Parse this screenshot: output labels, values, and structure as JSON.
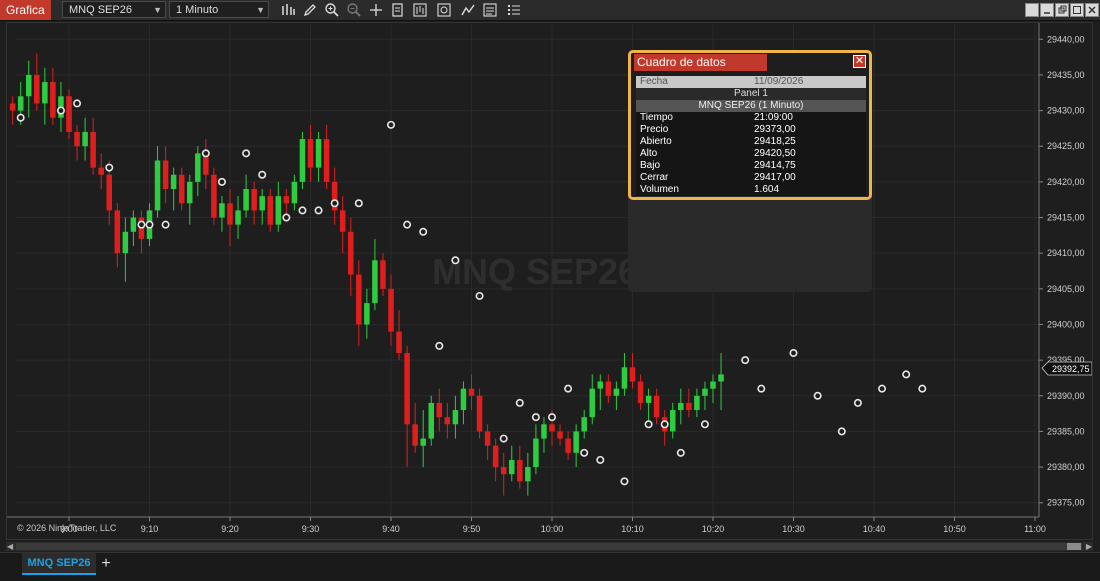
{
  "app": {
    "title": "Grafica"
  },
  "toolbar": {
    "instrument": "MNQ SEP26",
    "interval": "1 Minuto",
    "tools": [
      "bar-style-icon",
      "pencil-icon",
      "zoom-in-icon",
      "zoom-out-icon",
      "crosshair-icon",
      "properties-icon",
      "indicators-icon",
      "strategies-icon",
      "drawing-tools-icon",
      "data-box-icon",
      "list-icon"
    ]
  },
  "watermark": "MNQ SEP26",
  "copyright": "© 2026 NinjaTrader, LLC",
  "price_marker": "29392,75",
  "data_box": {
    "title": "Cuadro de datos",
    "date_label": "Fecha",
    "date_value": "11/09/2026",
    "panel": "Panel 1",
    "instrument": "MNQ SEP26 (1 Minuto)",
    "rows": [
      {
        "k": "Tiempo",
        "v": "21:09:00"
      },
      {
        "k": "Precio",
        "v": "29373,00"
      },
      {
        "k": "Abierto",
        "v": "29418,25"
      },
      {
        "k": "Alto",
        "v": "29420,50"
      },
      {
        "k": "Bajo",
        "v": "29414,75"
      },
      {
        "k": "Cerrar",
        "v": "29417,00"
      },
      {
        "k": "Volumen",
        "v": "1.604"
      }
    ]
  },
  "tabs": [
    {
      "label": "MNQ SEP26"
    }
  ],
  "chart_data": {
    "type": "candlestick",
    "x_ticks": [
      "9:00",
      "9:10",
      "9:20",
      "9:30",
      "9:40",
      "9:50",
      "10:00",
      "10:10",
      "10:20",
      "10:30",
      "10:40",
      "10:50",
      "11:00"
    ],
    "y_ticks": [
      "29440,00",
      "29435,00",
      "29430,00",
      "29425,00",
      "29420,00",
      "29415,00",
      "29410,00",
      "29405,00",
      "29400,00",
      "29395,00",
      "29390,00",
      "29385,00",
      "29380,00",
      "29375,00"
    ],
    "ylim": [
      29373,
      29442
    ],
    "start_minute": 533,
    "up_color": "#2ecc40",
    "down_color": "#e01e1e",
    "candles": [
      [
        29431,
        29432,
        29428,
        29430
      ],
      [
        29430,
        29434,
        29428,
        29432
      ],
      [
        29432,
        29437,
        29429,
        29435
      ],
      [
        29435,
        29438,
        29430,
        29431
      ],
      [
        29431,
        29436,
        29428,
        29434
      ],
      [
        29434,
        29436,
        29428,
        29429
      ],
      [
        29429,
        29434,
        29427,
        29432
      ],
      [
        29432,
        29433,
        29426,
        29427
      ],
      [
        29427,
        29428,
        29423,
        29425
      ],
      [
        29425,
        29429,
        29423,
        29427
      ],
      [
        29427,
        29429,
        29421,
        29422
      ],
      [
        29422,
        29424,
        29419,
        29421
      ],
      [
        29421,
        29423,
        29414,
        29416
      ],
      [
        29416,
        29417,
        29408,
        29410
      ],
      [
        29410,
        29415,
        29406,
        29413
      ],
      [
        29413,
        29416,
        29411,
        29415
      ],
      [
        29415,
        29416,
        29410,
        29412
      ],
      [
        29412,
        29417,
        29411,
        29416
      ],
      [
        29416,
        29425,
        29415,
        29423
      ],
      [
        29423,
        29425,
        29417,
        29419
      ],
      [
        29419,
        29422,
        29416,
        29421
      ],
      [
        29421,
        29422,
        29416,
        29417
      ],
      [
        29417,
        29421,
        29414,
        29420
      ],
      [
        29420,
        29425,
        29418,
        29424
      ],
      [
        29424,
        29426,
        29419,
        29421
      ],
      [
        29421,
        29422,
        29414,
        29415
      ],
      [
        29415,
        29418,
        29413,
        29417
      ],
      [
        29417,
        29419,
        29411,
        29414
      ],
      [
        29414,
        29418,
        29412,
        29416
      ],
      [
        29416,
        29421,
        29415,
        29419
      ],
      [
        29419,
        29420,
        29414,
        29416
      ],
      [
        29416,
        29419,
        29414,
        29418
      ],
      [
        29418,
        29419,
        29413,
        29414
      ],
      [
        29414,
        29420,
        29413,
        29418
      ],
      [
        29418,
        29419,
        29415,
        29417
      ],
      [
        29417,
        29421,
        29416,
        29420
      ],
      [
        29420,
        29427,
        29419,
        29426
      ],
      [
        29426,
        29428,
        29420,
        29422
      ],
      [
        29422,
        29427,
        29420,
        29426
      ],
      [
        29426,
        29428,
        29419,
        29420
      ],
      [
        29420,
        29422,
        29414,
        29416
      ],
      [
        29416,
        29418,
        29410,
        29413
      ],
      [
        29413,
        29415,
        29404,
        29407
      ],
      [
        29407,
        29409,
        29397,
        29400
      ],
      [
        29400,
        29405,
        29398,
        29403
      ],
      [
        29403,
        29412,
        29402,
        29409
      ],
      [
        29409,
        29410,
        29404,
        29405
      ],
      [
        29405,
        29407,
        29397,
        29399
      ],
      [
        29399,
        29402,
        29395,
        29396
      ],
      [
        29396,
        29397,
        29380,
        29386
      ],
      [
        29386,
        29389,
        29382,
        29383
      ],
      [
        29383,
        29388,
        29380,
        29384
      ],
      [
        29384,
        29390,
        29383,
        29389
      ],
      [
        29389,
        29391,
        29385,
        29387
      ],
      [
        29387,
        29389,
        29384,
        29386
      ],
      [
        29386,
        29390,
        29384,
        29388
      ],
      [
        29388,
        29392,
        29386,
        29391
      ],
      [
        29391,
        29393,
        29388,
        29390
      ],
      [
        29390,
        29391,
        29384,
        29385
      ],
      [
        29385,
        29386,
        29381,
        29383
      ],
      [
        29383,
        29384,
        29378,
        29380
      ],
      [
        29380,
        29382,
        29376,
        29379
      ],
      [
        29379,
        29383,
        29378,
        29381
      ],
      [
        29381,
        29383,
        29377,
        29378
      ],
      [
        29378,
        29382,
        29376,
        29380
      ],
      [
        29380,
        29386,
        29379,
        29384
      ],
      [
        29384,
        29387,
        29382,
        29386
      ],
      [
        29386,
        29388,
        29383,
        29385
      ],
      [
        29385,
        29386,
        29383,
        29384
      ],
      [
        29384,
        29385,
        29381,
        29382
      ],
      [
        29382,
        29386,
        29380,
        29385
      ],
      [
        29385,
        29388,
        29384,
        29387
      ],
      [
        29387,
        29393,
        29386,
        29391
      ],
      [
        29391,
        29393,
        29388,
        29392
      ],
      [
        29392,
        29393,
        29389,
        29390
      ],
      [
        29390,
        29392,
        29388,
        29391
      ],
      [
        29391,
        29396,
        29390,
        29394
      ],
      [
        29394,
        29396,
        29391,
        29392
      ],
      [
        29392,
        29393,
        29388,
        29389
      ],
      [
        29389,
        29391,
        29386,
        29390
      ],
      [
        29390,
        29391,
        29386,
        29387
      ],
      [
        29387,
        29388,
        29383,
        29385
      ],
      [
        29385,
        29389,
        29384,
        29388
      ],
      [
        29388,
        29391,
        29386,
        29389
      ],
      [
        29389,
        29391,
        29387,
        29388
      ],
      [
        29388,
        29391,
        29387,
        29390
      ],
      [
        29390,
        29392,
        29388,
        29391
      ],
      [
        29391,
        29393,
        29389,
        29392
      ],
      [
        29392,
        29396,
        29388,
        29393
      ]
    ],
    "markers": [
      [
        1,
        29429
      ],
      [
        6,
        29430
      ],
      [
        8,
        29431
      ],
      [
        12,
        29422
      ],
      [
        16,
        29414
      ],
      [
        17,
        29414
      ],
      [
        19,
        29414
      ],
      [
        24,
        29424
      ],
      [
        26,
        29420
      ],
      [
        29,
        29424
      ],
      [
        31,
        29421
      ],
      [
        34,
        29415
      ],
      [
        36,
        29416
      ],
      [
        38,
        29416
      ],
      [
        40,
        29417
      ],
      [
        43,
        29417
      ],
      [
        47,
        29428
      ],
      [
        49,
        29414
      ],
      [
        51,
        29413
      ],
      [
        53,
        29397
      ],
      [
        55,
        29409
      ],
      [
        58,
        29404
      ],
      [
        61,
        29384
      ],
      [
        63,
        29389
      ],
      [
        65,
        29387
      ],
      [
        67,
        29387
      ],
      [
        69,
        29391
      ],
      [
        71,
        29382
      ],
      [
        73,
        29381
      ],
      [
        76,
        29378
      ],
      [
        79,
        29386
      ],
      [
        81,
        29386
      ],
      [
        83,
        29382
      ],
      [
        86,
        29386
      ],
      [
        91,
        29395
      ],
      [
        93,
        29391
      ],
      [
        97,
        29396
      ],
      [
        100,
        29390
      ],
      [
        103,
        29385
      ],
      [
        105,
        29389
      ],
      [
        108,
        29391
      ],
      [
        111,
        29393
      ],
      [
        113,
        29391
      ]
    ]
  }
}
